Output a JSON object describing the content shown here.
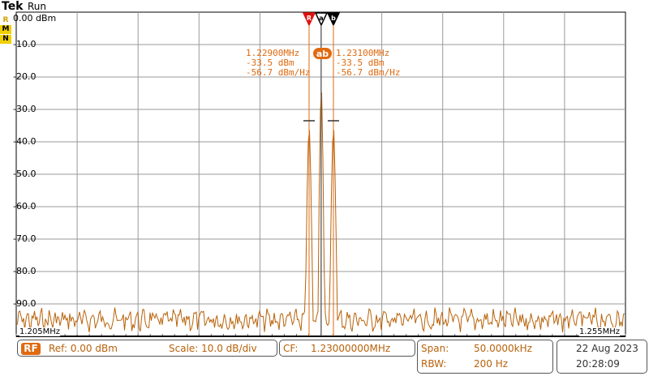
{
  "header": {
    "brand": "Tek",
    "status": "Run"
  },
  "side_flags": [
    "R",
    "M",
    "N"
  ],
  "y_axis": {
    "unit_label": "0.00 dBm",
    "ticks": [
      "-10.0",
      "-20.0",
      "-30.0",
      "-40.0",
      "-50.0",
      "-60.0",
      "-70.0",
      "-80.0",
      "-90.0"
    ]
  },
  "x_axis": {
    "start": "1.205MHz",
    "stop": "1.255MHz"
  },
  "markers": {
    "icons": [
      "R",
      "a",
      "b"
    ],
    "badge": "ab",
    "a": {
      "freq": "1.22900MHz",
      "level": "-33.5 dBm",
      "density": "-56.7 dBm/Hz"
    },
    "b": {
      "freq": "1.23100MHz",
      "level": "-33.5 dBm",
      "density": "-56.7 dBm/Hz"
    }
  },
  "bottom": {
    "rf_badge": "RF",
    "ref": "Ref: 0.00 dBm",
    "scale": "Scale: 10.0 dB/div",
    "cf_label": "CF:",
    "cf_value": "1.23000000MHz",
    "span_label": "Span:",
    "span_value": "50.0000kHz",
    "rbw_label": "RBW:",
    "rbw_value": "200 Hz",
    "date": "22 Aug 2023",
    "time": "20:28:09"
  },
  "colors": {
    "trace": "#b8620a",
    "marker": "#e06a10",
    "ref_marker": "#e01010",
    "grid": "#999999"
  }
}
